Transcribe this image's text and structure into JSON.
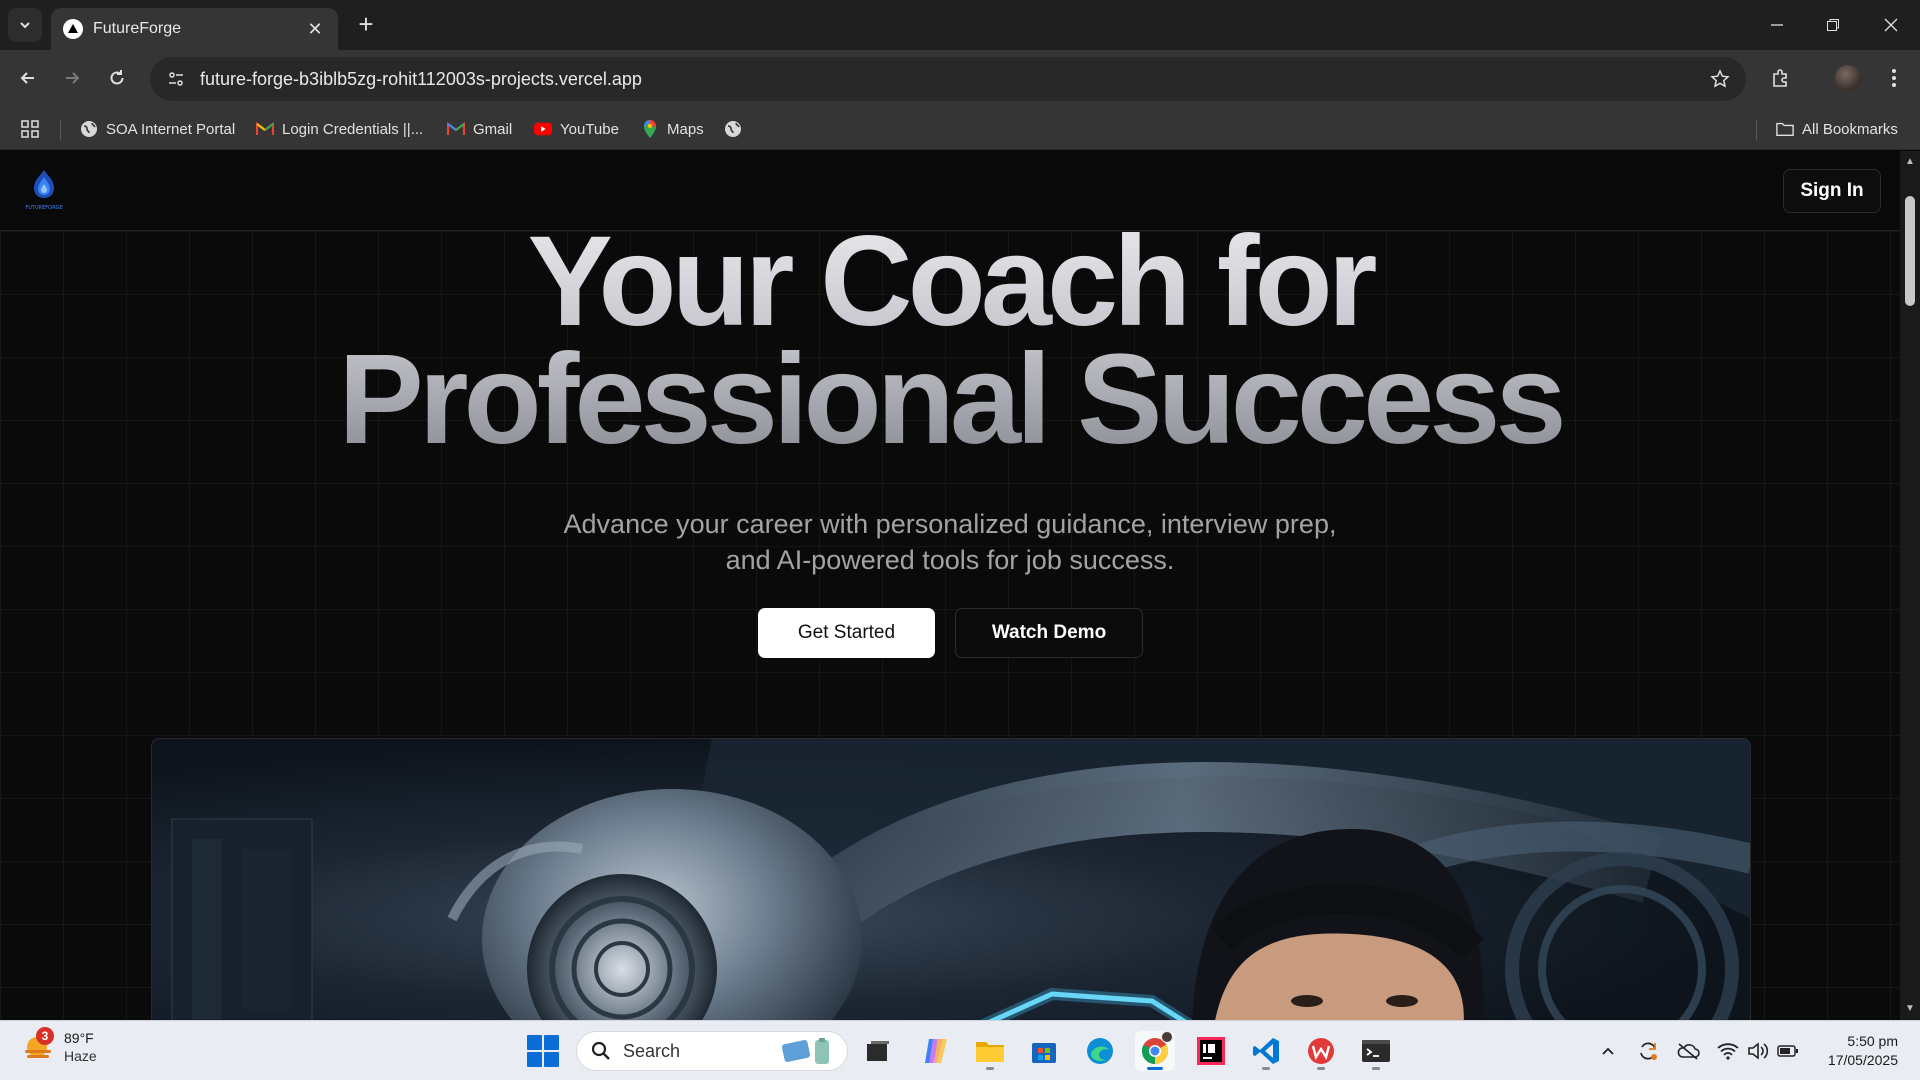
{
  "browser": {
    "tab_title": "FutureForge",
    "url": "future-forge-b3iblb5zg-rohit112003s-projects.vercel.app",
    "bookmarks": [
      {
        "label": "SOA Internet Portal",
        "icon": "globe-icon"
      },
      {
        "label": "Login Credentials ||...",
        "icon": "gmail-icon"
      },
      {
        "label": "Gmail",
        "icon": "gmail-icon"
      },
      {
        "label": "YouTube",
        "icon": "youtube-icon"
      },
      {
        "label": "Maps",
        "icon": "maps-icon"
      }
    ],
    "all_bookmarks_label": "All Bookmarks"
  },
  "site": {
    "logo_text": "FUTUREFORGE",
    "signin_label": "Sign In",
    "hero": {
      "title_line1": "Your Coach for",
      "title_line2": "Professional Success",
      "subtitle": "Advance your career with personalized guidance, interview prep, and AI-powered tools for job success.",
      "primary_cta": "Get Started",
      "secondary_cta": "Watch Demo"
    }
  },
  "taskbar": {
    "weather": {
      "badge": "3",
      "temp": "89°F",
      "condition": "Haze"
    },
    "search_placeholder": "Search",
    "clock_time": "5:50 pm",
    "clock_date": "17/05/2025"
  },
  "colors": {
    "page_bg": "#0a0a0a",
    "accent_blue": "#0a6cd7",
    "chrome_bg": "#353535"
  }
}
